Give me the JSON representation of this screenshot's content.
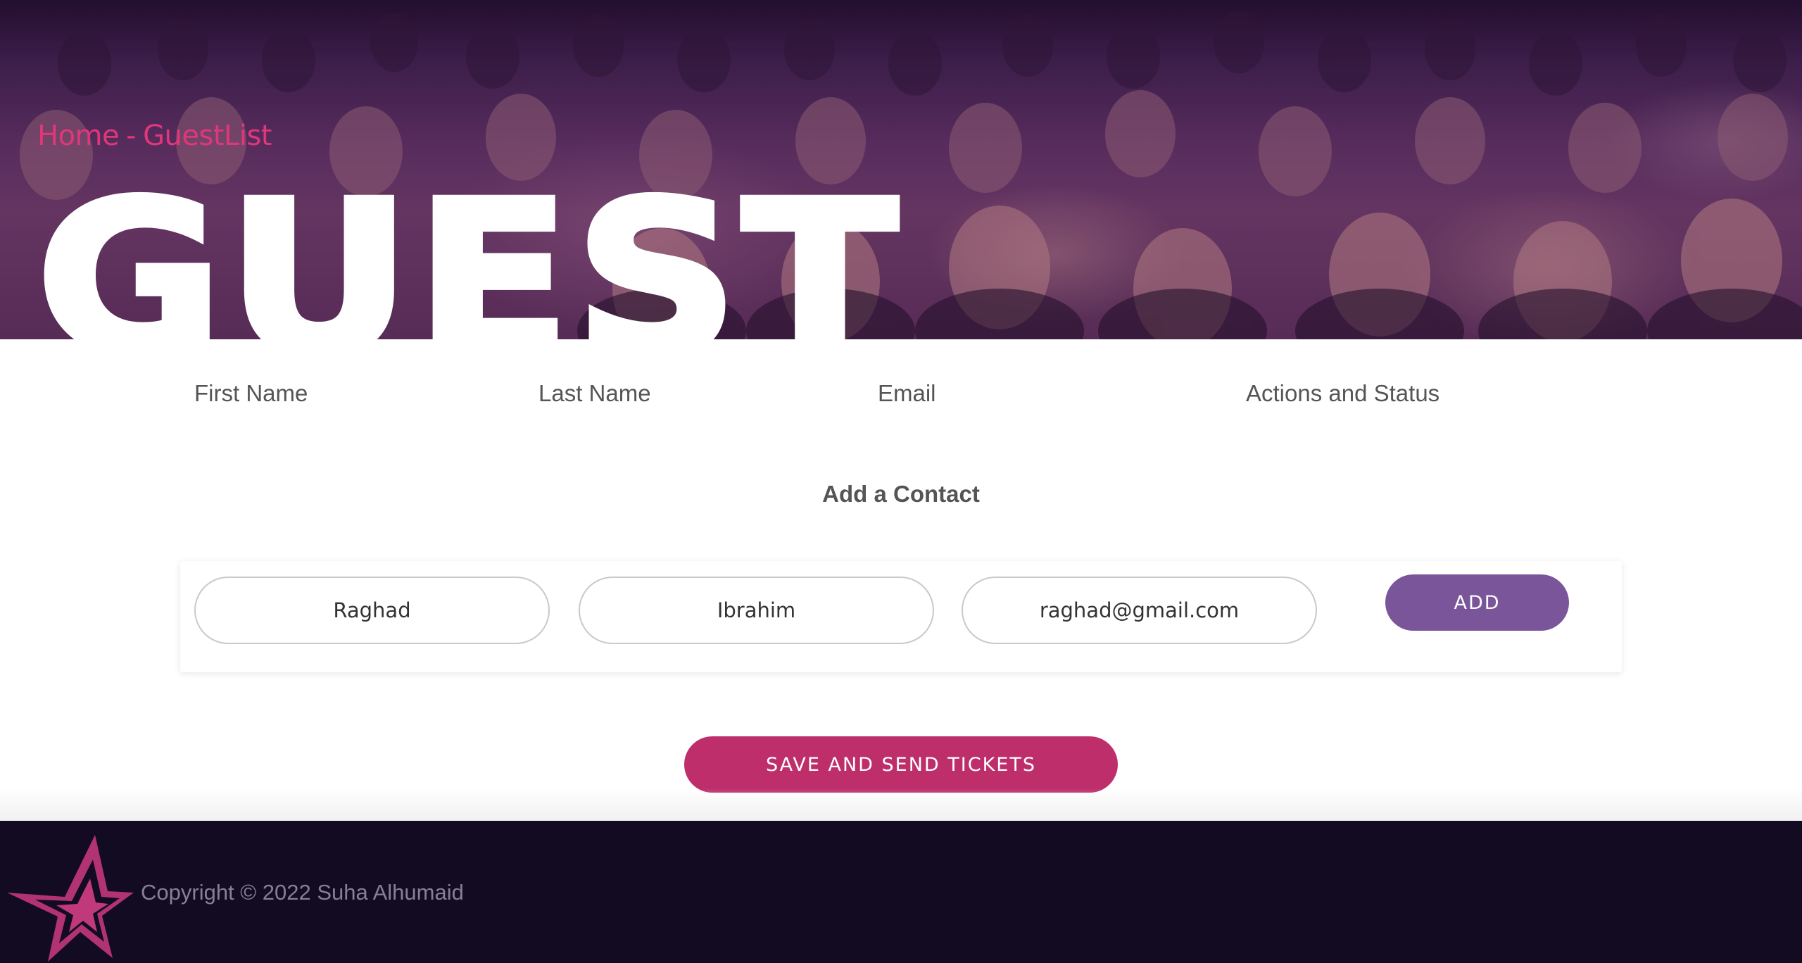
{
  "hero": {
    "breadcrumb_home": "Home",
    "breadcrumb_separator": "-",
    "breadcrumb_current": "GuestList",
    "title": "GUEST",
    "background_image": "crowd-audience-photo"
  },
  "table": {
    "headers": {
      "first_name": "First Name",
      "last_name": "Last Name",
      "email": "Email",
      "actions": "Actions and Status"
    },
    "rows": []
  },
  "add_contact": {
    "title": "Add a Contact",
    "first_name_value": "Raghad",
    "last_name_value": "Ibrahim",
    "email_value": "raghad@gmail.com",
    "add_label": "ADD"
  },
  "save_label": "SAVE AND SEND TICKETS",
  "footer": {
    "copyright": "Copyright © 2022 Suha Alhumaid",
    "logo_icon": "star-logo-icon"
  },
  "colors": {
    "accent_pink": "#bd2e6b",
    "breadcrumb_pink": "#e0367a",
    "add_purple": "#7a559a",
    "footer_bg": "#130b22"
  }
}
